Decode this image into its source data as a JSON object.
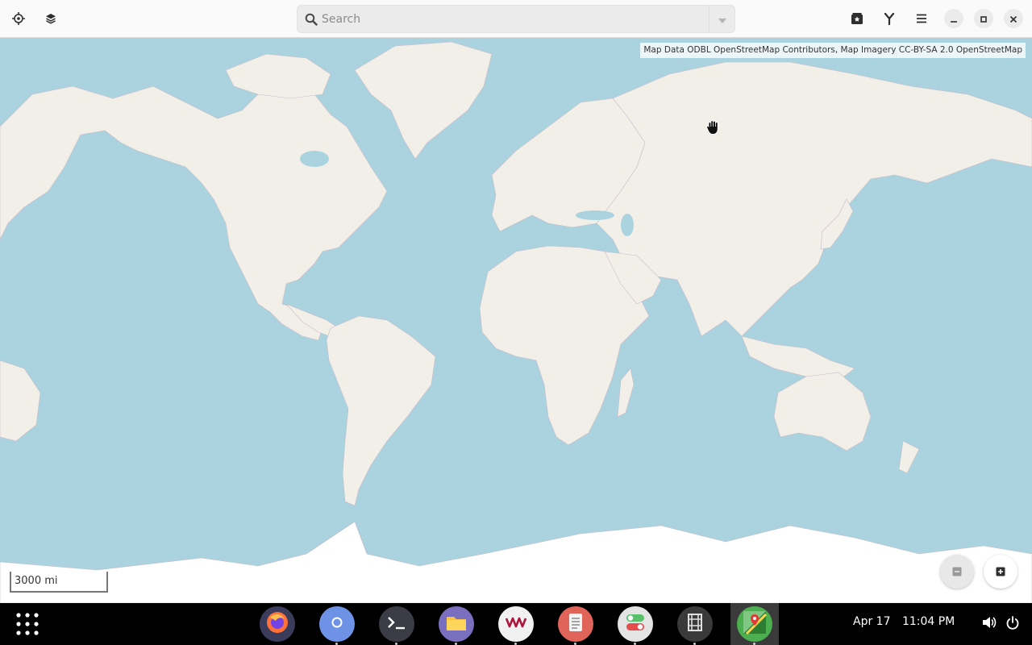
{
  "header": {
    "locate_icon": "crosshair-icon",
    "layers_icon": "layers-icon",
    "search": {
      "placeholder": "Search",
      "value": ""
    },
    "favorites_icon": "star-box-icon",
    "route_icon": "route-fork-icon",
    "menu_icon": "hamburger-menu-icon",
    "minimize_icon": "minimize-icon",
    "maximize_icon": "maximize-icon",
    "close_icon": "close-icon"
  },
  "map": {
    "attribution": "Map Data ODBL OpenStreetMap Contributors, Map Imagery CC-BY-SA 2.0 OpenStreetMap",
    "scale_label": "3000 mi",
    "zoom_out_icon": "minus-icon",
    "zoom_in_icon": "plus-icon",
    "cursor_icon": "grab-hand-icon",
    "colors": {
      "water": "#aad3df",
      "land": "#f2efe9",
      "ice": "#ffffff",
      "borders": "#b9a8b9"
    }
  },
  "taskbar": {
    "apps_icon": "app-grid-icon",
    "dock": [
      {
        "name": "Firefox",
        "icon": "firefox-icon",
        "color": "#3b3b5c"
      },
      {
        "name": "Chromium",
        "icon": "chromium-icon",
        "color": "#6e93e6"
      },
      {
        "name": "Terminal",
        "icon": "terminal-icon",
        "color": "#3c3c46"
      },
      {
        "name": "Files",
        "icon": "folder-icon",
        "color": "#7a6fbf"
      },
      {
        "name": "Virt Manager",
        "icon": "vm-icon",
        "color": "#f1f1f1"
      },
      {
        "name": "Text Editor",
        "icon": "document-icon",
        "color": "#e0645a"
      },
      {
        "name": "Tweaks",
        "icon": "toggles-icon",
        "color": "#e4e4e4"
      },
      {
        "name": "Boxes",
        "icon": "boxes-icon",
        "color": "#3a3a3a"
      },
      {
        "name": "Maps",
        "icon": "maps-icon",
        "color": "#4caf50"
      }
    ],
    "date": "Apr 17",
    "time": "11:04 PM",
    "volume_icon": "volume-icon",
    "power_icon": "power-icon"
  }
}
